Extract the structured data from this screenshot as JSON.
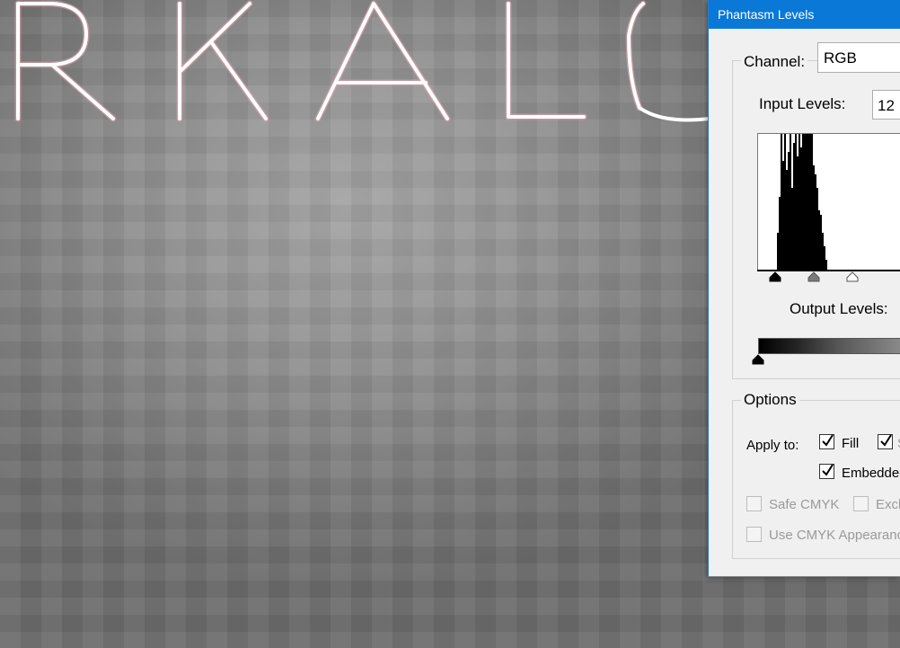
{
  "canvas": {
    "artwork_text": "RKALC"
  },
  "dialog": {
    "title": "Phantasm Levels",
    "channel_label": "Channel:",
    "channel_value": "RGB",
    "input_levels_label": "Input Levels:",
    "input_black_value": "12",
    "output_levels_label": "Output Levels:",
    "options_legend": "Options",
    "apply_to_label": "Apply to:",
    "checkboxes": {
      "fill": {
        "label": "Fill",
        "checked": true
      },
      "stroke": {
        "label": "S",
        "checked": true
      },
      "embedded": {
        "label": "Embedded",
        "checked": true
      },
      "safe_cmyk": {
        "label": "Safe CMYK",
        "checked": false,
        "disabled": true
      },
      "exclude": {
        "label": "Exclu",
        "checked": false,
        "disabled": true
      },
      "use_cmyk_appearance": {
        "label": "Use CMYK Appearance",
        "checked": false,
        "disabled": true
      }
    }
  },
  "colors": {
    "titlebar": "#0a78d7",
    "dialog_bg": "#f0f0f0",
    "artwork_stroke": "#ffffff",
    "artwork_glow": "#e7a3ad"
  }
}
